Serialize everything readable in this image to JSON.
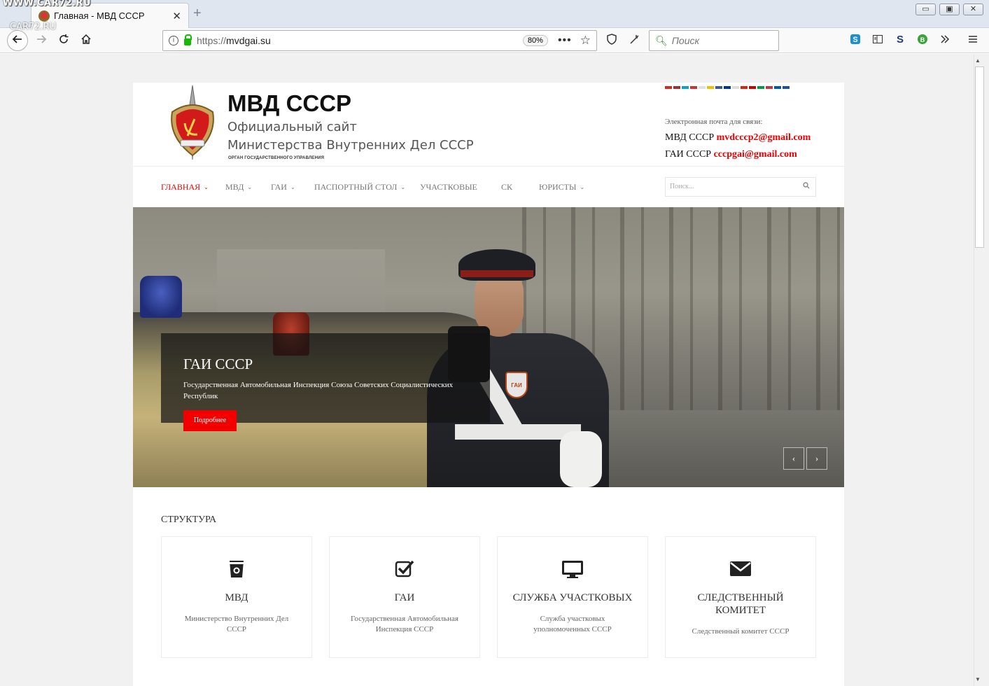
{
  "browser": {
    "watermark_top": "WWW.CAR72.RU",
    "watermark_side": "CAR72.RU",
    "tab_title": "Главная - МВД СССР",
    "tab_close": "✕",
    "new_tab": "+",
    "url_protocol": "https://",
    "url_host": "mvdgai.su",
    "zoom": "80%",
    "search_placeholder": "Поиск",
    "window_buttons": [
      "▭",
      "▣",
      "✕"
    ]
  },
  "site": {
    "title": "МВД СССР",
    "subtitle1": "Официальный сайт",
    "subtitle2": "Министерства Внутренних Дел СССР",
    "tagline": "ОРГАН ГОСУДАРСТВЕННОГО УПРАВЛЕНИЯ",
    "contacts_label": "Электронная почта для связи:",
    "contact1_prefix": "МВД СССР",
    "contact1_email": "mvdcccp2@gmail.com",
    "contact2_prefix": "ГАИ СССР",
    "contact2_email": "cccpgai@gmail.com",
    "flag_colors": [
      "#d52b1e",
      "#a03030",
      "#0aa0d0",
      "#cc3333",
      "#e0e0e0",
      "#f0c000",
      "#3b5998",
      "#0033a0",
      "#dddddd",
      "#d62612",
      "#c00",
      "#009a49",
      "#c6363c",
      "#0057b8",
      "#1e50a0"
    ]
  },
  "menu": {
    "items": [
      {
        "label": "Главная",
        "caret": "⌄"
      },
      {
        "label": "МВД",
        "caret": "⌄"
      },
      {
        "label": "ГАИ",
        "caret": "⌄"
      },
      {
        "label": "Паспортный стол",
        "caret": "⌄"
      },
      {
        "label": "Участковые",
        "caret": ""
      },
      {
        "label": "СК",
        "caret": ""
      },
      {
        "label": "Юристы",
        "caret": "⌄"
      }
    ],
    "search_placeholder": "Поиск..."
  },
  "slider": {
    "title": "ГАИ СССР",
    "text": "Государственная Автомобильная Инспекция Союза Советских Социалистических Республик",
    "button": "Подробнее",
    "prev": "‹",
    "next": "›",
    "badge_text": "ГАИ"
  },
  "structure": {
    "title": "Структура",
    "cards": [
      {
        "title": "МВД",
        "desc": "Министерство Внутренних Дел СССР",
        "icon": "police-cap-icon"
      },
      {
        "title": "ГАИ",
        "desc": "Государственная Автомобильная Инспекция СССР",
        "icon": "checkbox-icon"
      },
      {
        "title": "Служба участковых",
        "desc": "Служба участковых уполномоченных СССР",
        "icon": "monitor-icon"
      },
      {
        "title": "Следственный комитет",
        "desc": "Следственный комитет СССР",
        "icon": "envelope-icon"
      }
    ]
  }
}
